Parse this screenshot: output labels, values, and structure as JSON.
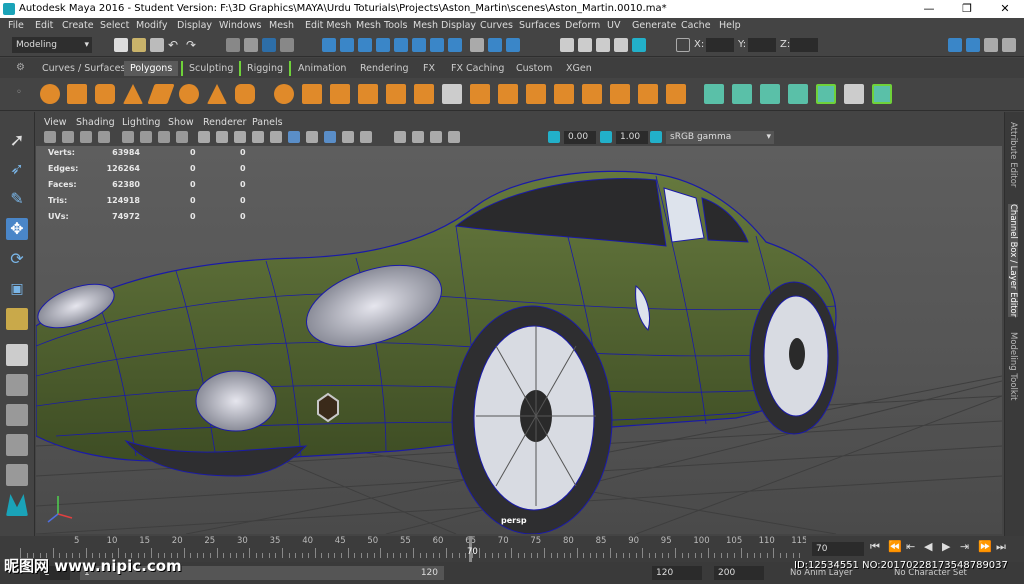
{
  "window": {
    "title": "Autodesk Maya 2016 - Student Version: F:\\3D Graphics\\MAYA\\Urdu Toturials\\Projects\\Aston_Martin\\scenes\\Aston_Martin.0010.ma*",
    "minimize": "—",
    "maximize": "❐",
    "close": "✕"
  },
  "menubar": [
    "File",
    "Edit",
    "Create",
    "Select",
    "Modify",
    "Display",
    "Windows",
    "Mesh",
    "Edit Mesh",
    "Mesh Tools",
    "Mesh Display",
    "Curves",
    "Surfaces",
    "Deform",
    "UV",
    "Generate",
    "Cache",
    "Help"
  ],
  "statusline": {
    "mode": "Modeling",
    "x_label": "X:",
    "y_label": "Y:",
    "z_label": "Z:"
  },
  "shelf_tabs": [
    "Curves / Surfaces",
    "Polygons",
    "Sculpting",
    "Rigging",
    "Animation",
    "Rendering",
    "FX",
    "FX Caching",
    "Custom",
    "XGen"
  ],
  "shelf_active": "Polygons",
  "viewport_menu": [
    "View",
    "Shading",
    "Lighting",
    "Show",
    "Renderer",
    "Panels"
  ],
  "viewport_tools": {
    "exposure": "0.00",
    "gamma": "1.00",
    "color_space": "sRGB gamma"
  },
  "hud": [
    {
      "label": "Verts:",
      "v1": "63984",
      "v2": "0",
      "v3": "0"
    },
    {
      "label": "Edges:",
      "v1": "126264",
      "v2": "0",
      "v3": "0"
    },
    {
      "label": "Faces:",
      "v1": "62380",
      "v2": "0",
      "v3": "0"
    },
    {
      "label": "Tris:",
      "v1": "124918",
      "v2": "0",
      "v3": "0"
    },
    {
      "label": "UVs:",
      "v1": "74972",
      "v2": "0",
      "v3": "0"
    }
  ],
  "camera_label": "persp",
  "right_tabs": [
    "Attribute Editor",
    "Channel Box / Layer Editor",
    "Modeling Toolkit"
  ],
  "time_slider": {
    "ticks": [
      "5",
      "10",
      "15",
      "20",
      "25",
      "30",
      "35",
      "40",
      "45",
      "50",
      "55",
      "60",
      "65",
      "70",
      "75",
      "80",
      "85",
      "90",
      "95",
      "100",
      "105",
      "110",
      "115",
      "12"
    ],
    "current_frame": "70",
    "current_field": "70"
  },
  "range": {
    "start": "1",
    "range_start": "1",
    "range_end": "120",
    "end": "120",
    "anim_end": "200",
    "anim_layer": "No Anim Layer",
    "char_set": "No Character Set"
  },
  "watermark": "昵图网 www.nipic.com",
  "image_id": "ID:12534551 NO:20170228173548789037",
  "colors": {
    "car_body": "#4b5e2e",
    "wireframe": "#1a1aa8",
    "accent": "#1aa3b8",
    "shelf_icon": "#e08a2a"
  }
}
